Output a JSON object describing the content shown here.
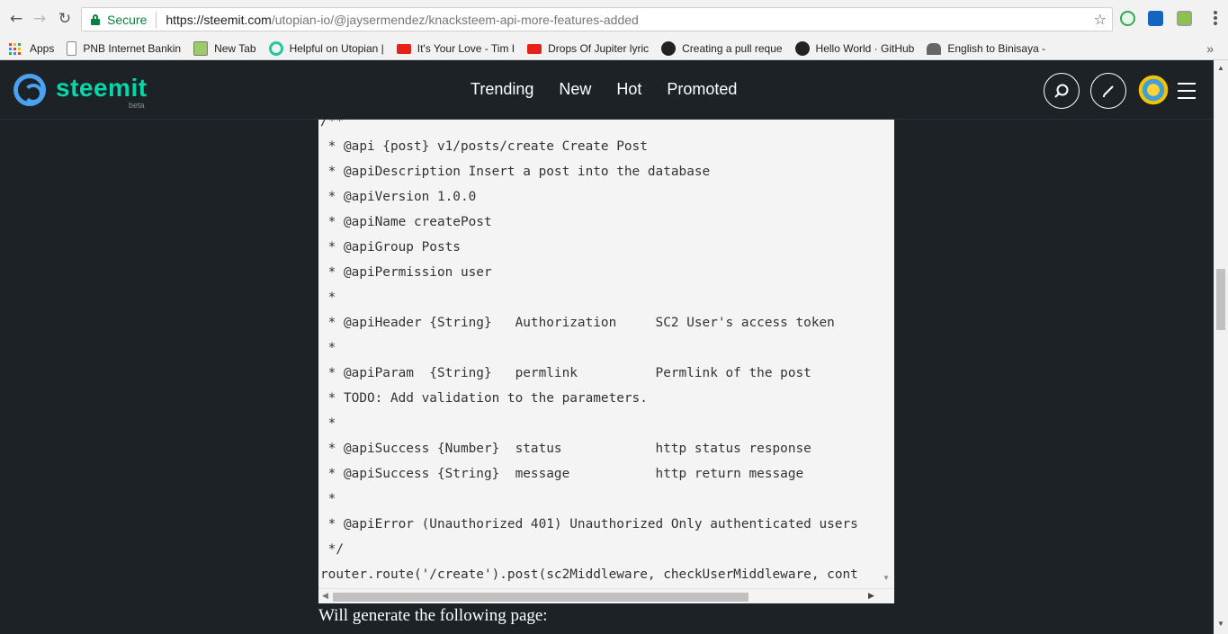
{
  "browser": {
    "secure_label": "Secure",
    "url_host": "https://steemit.com",
    "url_path": "/utopian-io/@jaysermendez/knacksteem-api-more-features-added"
  },
  "bookmarks": {
    "items": [
      {
        "label": "Apps",
        "icon": "apps-icon"
      },
      {
        "label": "PNB Internet Bankin",
        "icon": "page-icon"
      },
      {
        "label": "New Tab",
        "icon": "newtab-icon"
      },
      {
        "label": "Helpful on Utopian |",
        "icon": "utopian-icon"
      },
      {
        "label": "It's Your Love - Tim I",
        "icon": "youtube-icon"
      },
      {
        "label": "Drops Of Jupiter lyric",
        "icon": "youtube-icon"
      },
      {
        "label": "Creating a pull reque",
        "icon": "github-icon"
      },
      {
        "label": "Hello World · GitHub",
        "icon": "github-icon"
      },
      {
        "label": "English to Binisaya -",
        "icon": "bank-icon"
      }
    ],
    "more": "»"
  },
  "site": {
    "logo_text": "steemit",
    "logo_beta": "beta",
    "nav": [
      "Trending",
      "New",
      "Hot",
      "Promoted"
    ]
  },
  "code": {
    "lines": [
      "/**",
      " * @api {post} v1/posts/create Create Post",
      " * @apiDescription Insert a post into the database",
      " * @apiVersion 1.0.0",
      " * @apiName createPost",
      " * @apiGroup Posts",
      " * @apiPermission user",
      " *",
      " * @apiHeader {String}   Authorization     SC2 User's access token",
      " *",
      " * @apiParam  {String}   permlink          Permlink of the post",
      " * TODO: Add validation to the parameters.",
      " *",
      " * @apiSuccess {Number}  status            http status response",
      " * @apiSuccess {String}  message           http return message",
      " *",
      " * @apiError (Unauthorized 401) Unauthorized Only authenticated users",
      " */",
      "router.route('/create').post(sc2Middleware, checkUserMiddleware, cont"
    ]
  },
  "caption": "Will generate the following page:",
  "colors": {
    "steemit_green": "#06d6a9",
    "logo_blue": "#4ba2f2",
    "header_bg": "#1c2226",
    "secure_green": "#0b8043"
  }
}
